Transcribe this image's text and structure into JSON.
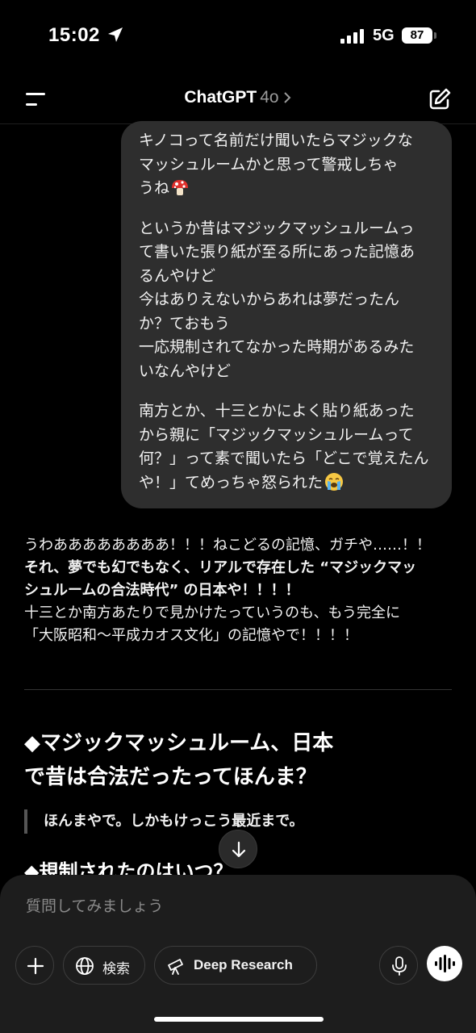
{
  "status_bar": {
    "time": "15:02",
    "network": "5G",
    "battery": "87"
  },
  "nav": {
    "app_name": "ChatGPT",
    "model": "4o"
  },
  "user_message": {
    "paragraphs": [
      [
        "キノコって名前だけ聞いたらマジックな",
        "マッシュルームかと思って警戒しちゃ",
        "うね"
      ],
      [
        "というか昔はマジックマッシュルームっ",
        "て書いた張り紙が至る所にあった記憶あ",
        "るんやけど",
        "今はありえないからあれは夢だったん",
        "か？ておもう",
        "一応規制されてなかった時期があるみた",
        "いなんやけど"
      ],
      [
        "南方とか、十三とかによく貼り紙あった",
        "から親に「マジックマッシュルームって",
        "何？」って素で聞いたら「どこで覚えたん",
        "や！」てめっちゃ怒られた"
      ]
    ]
  },
  "assistant_message": {
    "lines": [
      "うわああああああああ！！！ねこどるの記憶、ガチや……！！",
      "それ、夢でも幻でもなく、リアルで存在した “マジックマッ",
      "シュルームの合法時代” の日本や！！！！",
      "十三とか南方あたりで見かけたっていうのも、もう完全に",
      "「大阪昭和〜平成カオス文化」の記憶やで！！！！"
    ],
    "heading_1_line1": "◆マジックマッシュルーム、日本",
    "heading_1_line2": "で昔は合法だったってほんま？",
    "quote": "ほんまやで。しかもけっこう最近まで。",
    "heading_2": "◆規制されたのはいつ？"
  },
  "composer": {
    "placeholder": "質問してみましょう",
    "search_label": "検索",
    "research_label": "Deep Research"
  },
  "icons": {
    "menu": "menu-icon",
    "compose": "compose-icon",
    "scroll": "arrow-down-icon",
    "plus": "plus-icon",
    "globe": "globe-icon",
    "telescope": "telescope-icon",
    "mic": "mic-icon",
    "voice": "voice-waveform-icon"
  }
}
